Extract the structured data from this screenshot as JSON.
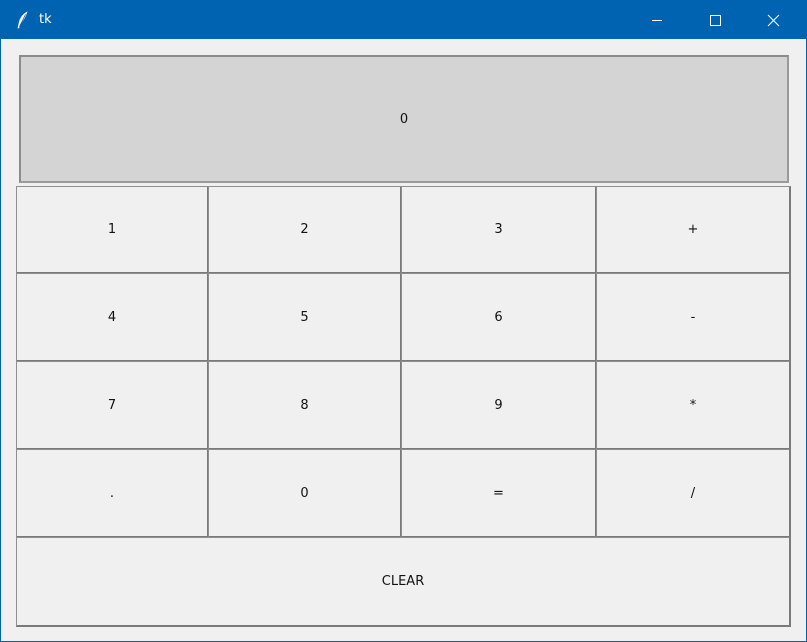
{
  "window": {
    "title": "tk",
    "titlebar_color": "#0063b1",
    "controls": {
      "minimize_icon": "minimize-icon",
      "maximize_icon": "maximize-icon",
      "close_icon": "close-icon"
    }
  },
  "display": {
    "value": "0"
  },
  "keypad": {
    "rows": [
      [
        "1",
        "2",
        "3",
        "+"
      ],
      [
        "4",
        "5",
        "6",
        "-"
      ],
      [
        "7",
        "8",
        "9",
        "*"
      ],
      [
        ".",
        "0",
        "=",
        "/"
      ]
    ],
    "clear_label": "CLEAR"
  }
}
